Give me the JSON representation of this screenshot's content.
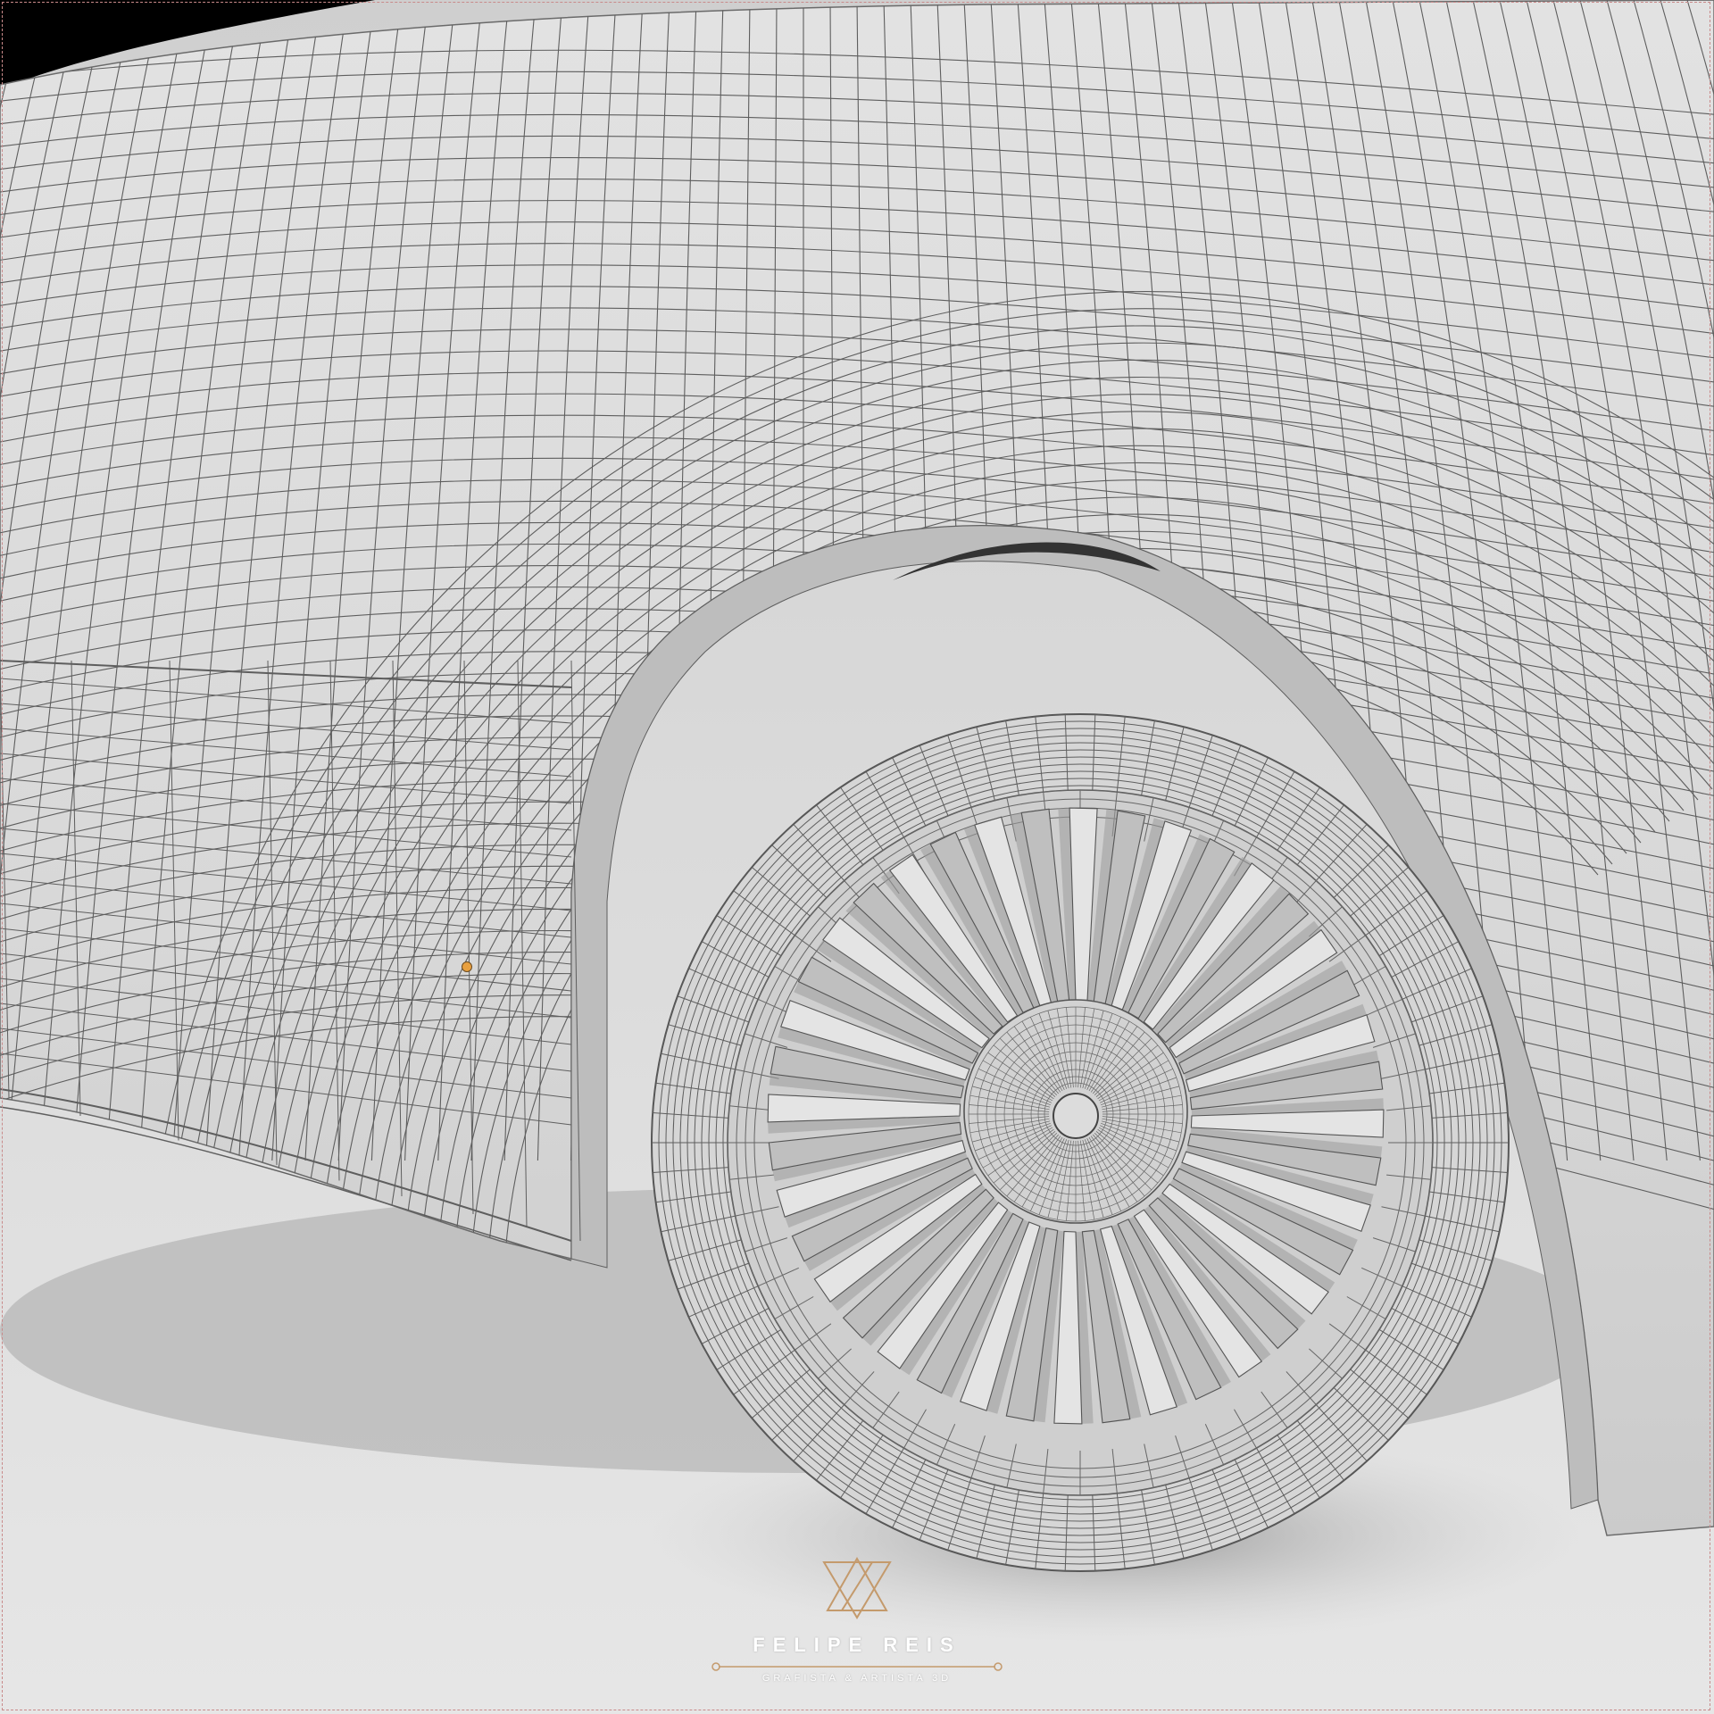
{
  "render": {
    "subject": "wireframe-car-front-wheel",
    "colors": {
      "background": "#d4d4d4",
      "body_surface": "#dcdcdc",
      "wire": "#5a5a5a",
      "shadow": "#8a8a8a",
      "accent_dot": "#e8a040",
      "watermark_gold": "#c49a6c"
    }
  },
  "watermark": {
    "logo_icon": "triangle-logo-icon",
    "name": "FELIPE REIS",
    "subtitle": "GRAFISTA & ARTISTA 3D"
  }
}
